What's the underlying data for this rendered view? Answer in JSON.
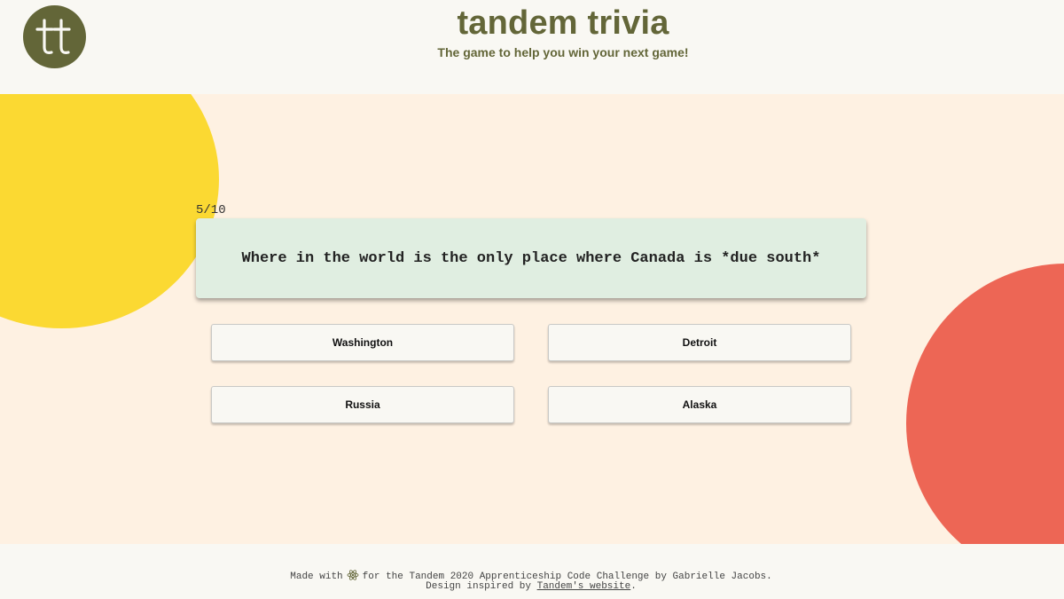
{
  "header": {
    "logo_text": "tt",
    "title": "tandem trivia",
    "subtitle": "The game to help you win your next game!"
  },
  "quiz": {
    "progress": "5/10",
    "question": "Where in the world is the only place where Canada is *due south*",
    "answers": [
      "Washington",
      "Detroit",
      "Russia",
      "Alaska"
    ]
  },
  "footer": {
    "made_with": "Made with",
    "icon": "react-icon",
    "line1_rest": "for the Tandem 2020 Apprenticeship Code Challenge by Gabrielle Jacobs.",
    "design_prefix": "Design inspired by",
    "design_link": "Tandem's website",
    "design_suffix": "."
  },
  "colors": {
    "brand_olive": "#636638",
    "yellow": "#fbd932",
    "red": "#ed6655",
    "band": "#fef1e2",
    "question_card": "#e0eee1"
  }
}
